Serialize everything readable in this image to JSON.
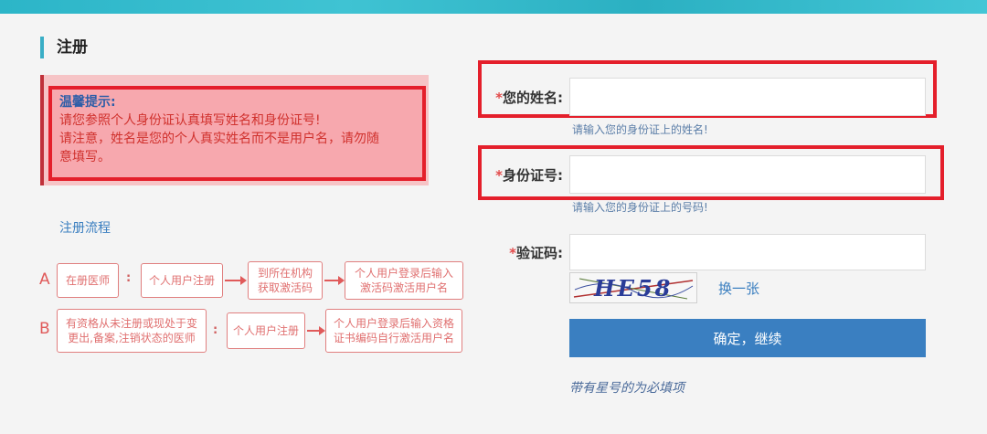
{
  "header": {
    "section_title": "注册"
  },
  "tip": {
    "title": "温馨提示:",
    "lines": [
      "请您参照个人身份证认真填写姓名和身份证号!",
      "请注意，姓名是您的个人真实姓名而不是用户名，请勿随",
      "意填写。"
    ]
  },
  "flow": {
    "title": "注册流程",
    "row_a": {
      "letter": "A",
      "steps": [
        "在册医师",
        "个人用户注册",
        "到所在机构\n获取激活码",
        "个人用户登录后输入\n激活码激活用户名"
      ],
      "colon": ":"
    },
    "row_b": {
      "letter": "B",
      "steps": [
        "有资格从未注册或现处于变\n更出,备案,注销状态的医师",
        "个人用户注册",
        "个人用户登录后输入资格\n证书编码自行激活用户名"
      ],
      "colon": ":"
    }
  },
  "form": {
    "required_star": "*",
    "name_label": "您的姓名:",
    "name_value": "",
    "name_hint": "请输入您的身份证上的姓名!",
    "id_label": "身份证号:",
    "id_value": "",
    "id_hint": "请输入您的身份证上的号码!",
    "captcha_label": "验证码:",
    "captcha_value": "",
    "captcha_image_text": "HE58",
    "refresh_label": "换一张",
    "submit_label": "确定，继续",
    "required_note": "带有星号的为必填项"
  },
  "colors": {
    "accent": "#3a7fc1",
    "highlight": "#e41f2b",
    "tip_bg": "#f7a8ae"
  }
}
